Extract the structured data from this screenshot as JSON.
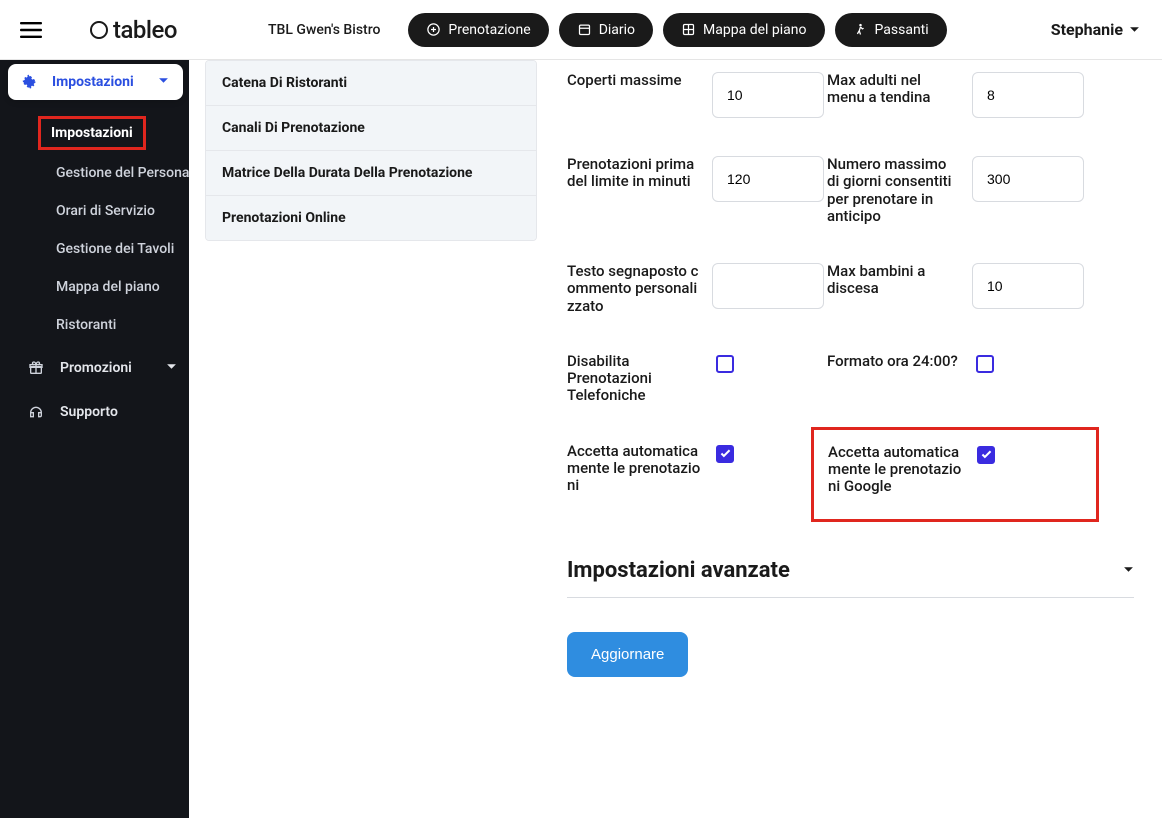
{
  "header": {
    "logo": "tableo",
    "restaurant": "TBL Gwen's Bistro",
    "pills": {
      "booking": "Prenotazione",
      "diary": "Diario",
      "floormap": "Mappa del piano",
      "walkins": "Passanti"
    },
    "user": "Stephanie"
  },
  "sidebar": {
    "settings_chip": "Impostazioni",
    "items": [
      "Impostazioni",
      "Gestione del Personale",
      "Orari di Servizio",
      "Gestione dei Tavoli",
      "Mappa del piano",
      "Ristoranti"
    ],
    "promo": "Promozioni",
    "support": "Supporto"
  },
  "secnav": [
    "Catena Di Ristoranti",
    "Canali Di Prenotazione",
    "Matrice Della Durata Della Prenotazione",
    "Prenotazioni Online"
  ],
  "form": {
    "max_covers_label": "Coperti massime",
    "max_covers_value": "10",
    "max_adults_label": "Max adulti nel menu a tendina",
    "max_adults_value": "8",
    "cutoff_label": "Prenotazioni prima del limite in minuti",
    "cutoff_value": "120",
    "advance_days_label": "Numero massimo di giorni consentiti per prenotare in anticipo",
    "advance_days_value": "300",
    "placeholder_label": "Testo segnaposto commento personalizzato",
    "placeholder_value": "",
    "max_children_label": "Max bambini a discesa",
    "max_children_value": "10",
    "disable_phone_label": "Disabilita Prenotazioni Telefoniche",
    "hour24_label": "Formato ora 24:00?",
    "auto_accept_label": "Accetta automaticamente le prenotazioni",
    "auto_accept_google_label": "Accetta automaticamente le prenotazioni Google"
  },
  "advanced_heading": "Impostazioni avanzate",
  "update_button": "Aggiornare"
}
